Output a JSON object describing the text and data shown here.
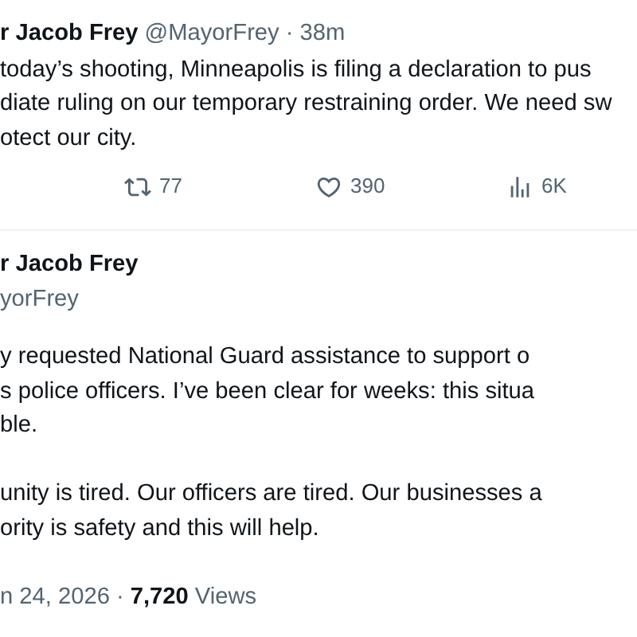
{
  "tweets": [
    {
      "author": "r Jacob Frey",
      "handle": "@MayorFrey",
      "separator": "·",
      "time": "38m",
      "paragraphs": [
        [
          "today’s shooting, Minneapolis is filing a declaration to pus",
          "diate ruling on our temporary restraining order. We need sw",
          "otect our city."
        ]
      ],
      "actions": [
        {
          "kind": "repost",
          "count": "77"
        },
        {
          "kind": "like",
          "count": "390"
        },
        {
          "kind": "views",
          "count": "6K"
        }
      ]
    },
    {
      "author": "r Jacob Frey",
      "handle": "yorFrey",
      "paragraphs": [
        [
          "y requested National Guard assistance to support o",
          "s police officers. I’ve been clear for weeks: this situa",
          "ble."
        ],
        [
          "unity is tired. Our officers are tired. Our businesses a",
          "ority is safety and this will help."
        ]
      ],
      "date": "n 24, 2026",
      "separator": "·",
      "views_count": "7,720",
      "views_label": "Views"
    }
  ]
}
